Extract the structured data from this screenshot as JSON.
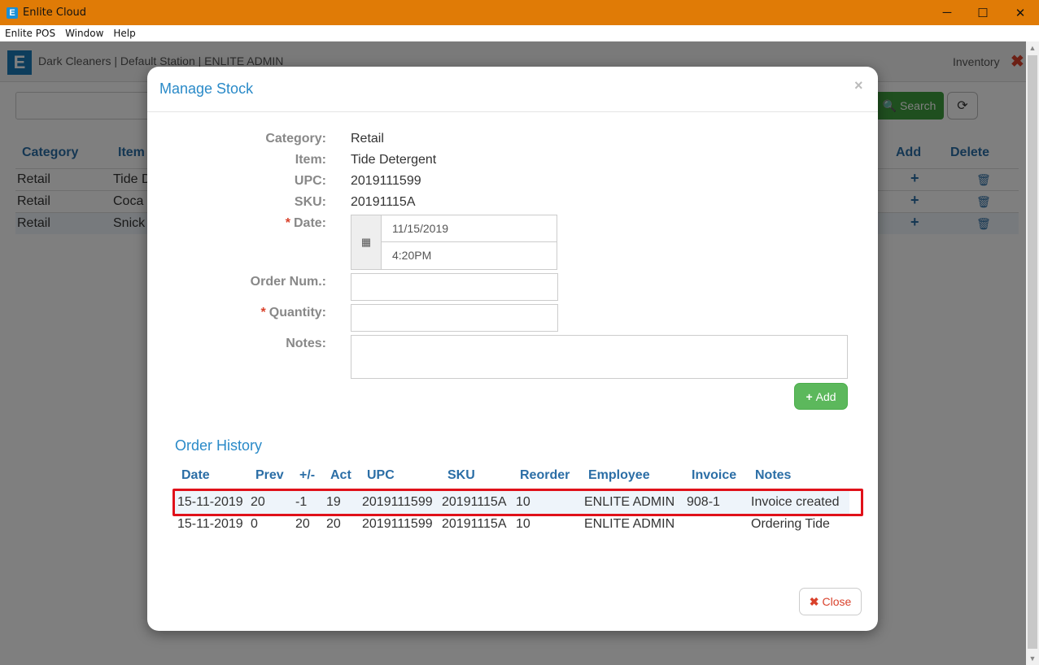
{
  "window": {
    "title": "Enlite Cloud",
    "icon_letter": "E",
    "minimize": "─",
    "maximize": "☐",
    "close": "✕"
  },
  "menu": [
    "Enlite POS",
    "Window",
    "Help"
  ],
  "app": {
    "title": "Dark Cleaners | Default Station | ENLITE ADMIN",
    "logo_letter": "E",
    "section": "Inventory",
    "search_label": "Search",
    "columns": {
      "category": "Category",
      "item": "Item",
      "add": "Add",
      "delete": "Delete"
    },
    "rows": [
      {
        "category": "Retail",
        "item": "Tide D"
      },
      {
        "category": "Retail",
        "item": "Coca"
      },
      {
        "category": "Retail",
        "item": "Snick"
      }
    ]
  },
  "modal": {
    "title": "Manage Stock",
    "close_x": "×",
    "labels": {
      "category": "Category:",
      "item": "Item:",
      "upc": "UPC:",
      "sku": "SKU:",
      "date": "Date:",
      "order_num": "Order Num.:",
      "quantity": "Quantity:",
      "notes": "Notes:"
    },
    "required_mark": "*",
    "values": {
      "category": "Retail",
      "item": "Tide Detergent",
      "upc": "2019111599",
      "sku": "20191115A",
      "date": "11/15/2019",
      "time": "4:20PM",
      "order_num": "",
      "quantity": "",
      "notes": ""
    },
    "add_button": "Add",
    "history_title": "Order History",
    "history_columns": [
      "Date",
      "Prev",
      "+/-",
      "Act",
      "UPC",
      "SKU",
      "Reorder",
      "Employee",
      "Invoice",
      "Notes"
    ],
    "history_rows": [
      [
        "15-11-2019",
        "20",
        "-1",
        "19",
        "2019111599",
        "20191115A",
        "10",
        "ENLITE ADMIN",
        "908-1",
        "Invoice created"
      ],
      [
        "15-11-2019",
        "0",
        "20",
        "20",
        "2019111599",
        "20191115A",
        "10",
        "ENLITE ADMIN",
        "",
        "Ordering Tide"
      ]
    ],
    "close_button": "Close"
  },
  "colors": {
    "titlebar": "#e07b06",
    "accent": "#2a8ac8",
    "success": "#5cb85c",
    "danger": "#d9412b",
    "highlight": "#e0111a"
  }
}
